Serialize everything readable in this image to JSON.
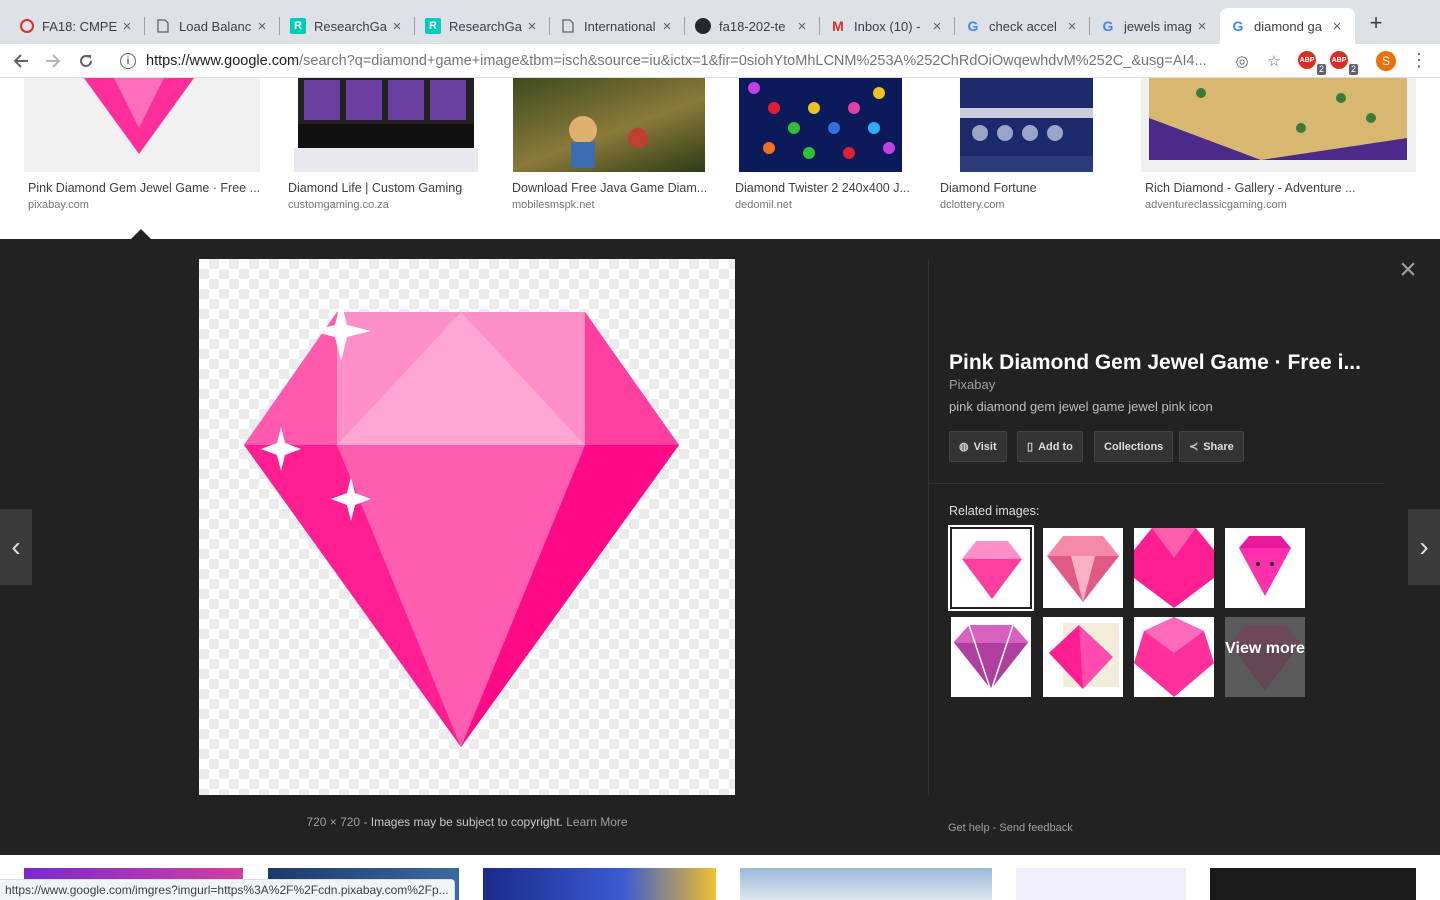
{
  "browser": {
    "tabs": [
      {
        "title": "FA18: CMPE",
        "favicon": "sjsu-icon",
        "active": false
      },
      {
        "title": "Load Balanc",
        "favicon": "page-icon",
        "active": false
      },
      {
        "title": "ResearchGa",
        "favicon": "researchgate-icon",
        "active": false
      },
      {
        "title": "ResearchGa",
        "favicon": "researchgate-icon",
        "active": false
      },
      {
        "title": "International",
        "favicon": "page-icon",
        "active": false
      },
      {
        "title": "fa18-202-te",
        "favicon": "github-icon",
        "active": false
      },
      {
        "title": "Inbox (10) -",
        "favicon": "gmail-icon",
        "active": false
      },
      {
        "title": "check accel",
        "favicon": "google-icon",
        "active": false
      },
      {
        "title": "jewels imag",
        "favicon": "google-icon",
        "active": false
      },
      {
        "title": "diamond ga",
        "favicon": "google-icon",
        "active": true
      }
    ],
    "new_tab": "+",
    "url_host": "https://www.google.com",
    "url_rest": "/search?q=diamond+game+image&tbm=isch&source=iu&ictx=1&fir=0siohYtoMhLCNM%253A%252ChRdOiOwqewhdvM%252C_&usg=AI4...",
    "extensions": [
      {
        "label": "ABP",
        "badge": "2"
      },
      {
        "label": "ABP",
        "badge": "2"
      }
    ],
    "profile_initial": "S"
  },
  "results": [
    {
      "title": "Pink Diamond Gem Jewel Game · Free ...",
      "source": "pixabay.com"
    },
    {
      "title": "Diamond Life | Custom Gaming",
      "source": "customgaming.co.za"
    },
    {
      "title": "Download Free Java Game Diam...",
      "source": "mobilesmspk.net"
    },
    {
      "title": "Diamond Twister 2 240x400 J...",
      "source": "dedomil.net"
    },
    {
      "title": "Diamond Fortune",
      "source": "dclottery.com"
    },
    {
      "title": "Rich Diamond - Gallery - Adventure ...",
      "source": "adventureclassicgaming.com"
    }
  ],
  "preview": {
    "title": "Pink Diamond Gem Jewel Game · Free i...",
    "source": "Pixabay",
    "description": "pink diamond gem jewel game jewel pink icon",
    "buttons": {
      "visit": "Visit",
      "add_to": "Add to",
      "collections": "Collections",
      "share": "Share"
    },
    "dimensions": "720 × 720",
    "sep": "-",
    "copyright": "Images may be subject to copyright.",
    "learn_more": "Learn More",
    "related_heading": "Related images:",
    "view_more": "View more",
    "get_help": "Get help",
    "feedback_sep": "-",
    "send_feedback": "Send feedback"
  },
  "status_url": "https://www.google.com/imgres?imgurl=https%3A%2F%2Fcdn.pixabay.com%2Fp...",
  "colors": {
    "accent_pink": "#ff1493",
    "panel_bg": "#222222",
    "gem_light": "#ff7ac0"
  }
}
